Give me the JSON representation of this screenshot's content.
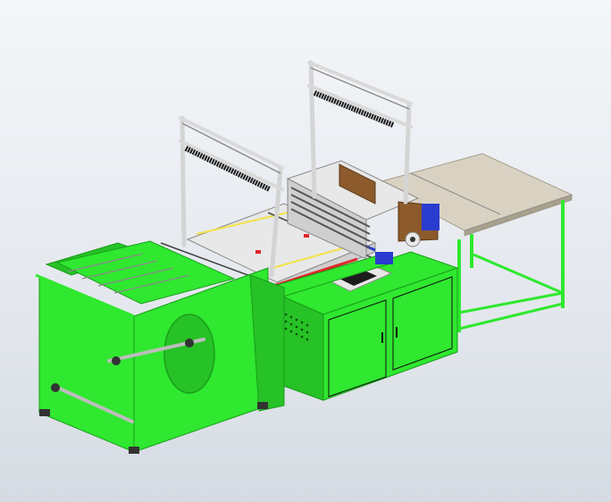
{
  "scene": {
    "subject": "bag-making-machine-cad-model",
    "colors": {
      "frame_green": "#2fe82f",
      "frame_green_dark": "#1a9e1a",
      "frame_green_shade": "#26c226",
      "table_top": "#d9d2c3",
      "table_edge": "#a89f8c",
      "steel": "#e8e8e8",
      "steel_dark": "#8a8a8a",
      "belt_black": "#1a1a1a",
      "roller_brown": "#8c5a2b",
      "accent_blue": "#2a3ccf",
      "accent_red": "#e02828",
      "accent_yellow": "#f2e24a",
      "screen": "#1c1c1c",
      "background": "#e6e9ee"
    },
    "icons": {
      "control_panel": "touchscreen-icon",
      "unwind_unit": "unwind-roll-icon"
    }
  }
}
